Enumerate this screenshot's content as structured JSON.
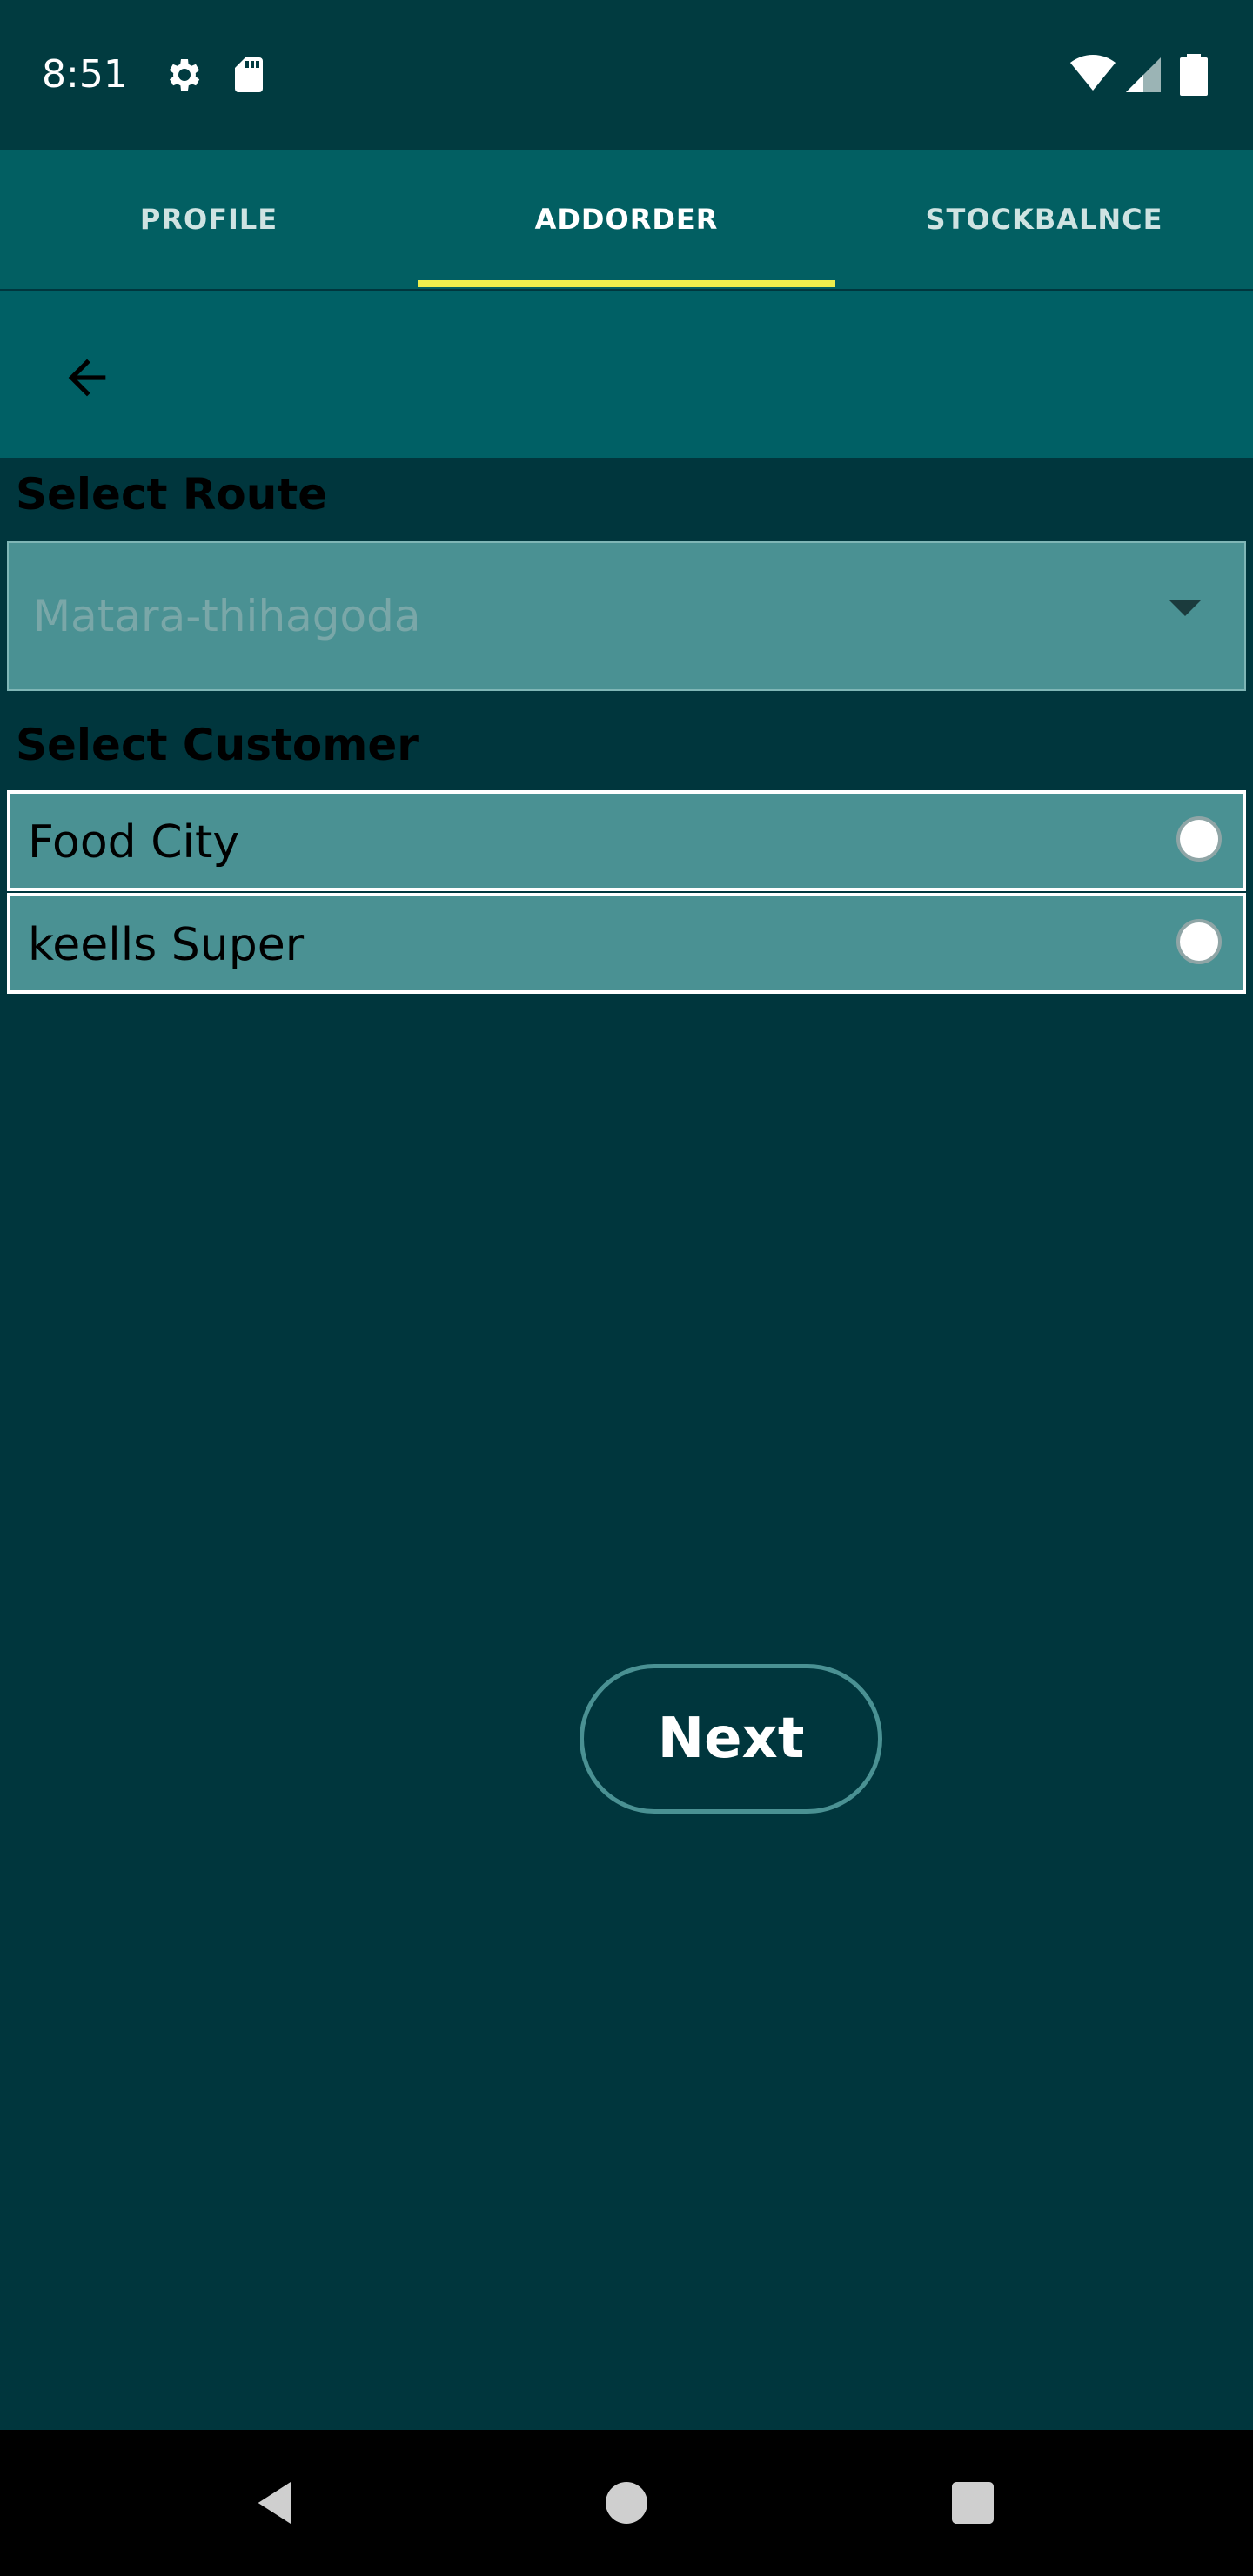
{
  "status_bar": {
    "time": "8:51",
    "icons": [
      "gear-icon",
      "sd-card-icon",
      "wifi-icon",
      "signal-icon",
      "battery-icon"
    ]
  },
  "tabs": [
    {
      "label": "PROFILE",
      "active": false
    },
    {
      "label": "ADDORDER",
      "active": true
    },
    {
      "label": "STOCKBALNCE",
      "active": false
    }
  ],
  "toolbar": {
    "back_icon": "arrow-left-icon"
  },
  "route": {
    "label": "Select Route",
    "selected": "Matara-thihagoda"
  },
  "customer": {
    "label": "Select Customer",
    "items": [
      {
        "name": "Food City",
        "selected": false
      },
      {
        "name": "keells Super",
        "selected": false
      }
    ]
  },
  "next_button": {
    "label": "Next"
  },
  "nav_bar": {
    "icons": [
      "back-triangle-icon",
      "home-circle-icon",
      "recents-square-icon"
    ]
  },
  "colors": {
    "background": "#00363d",
    "tab_bar": "#025f62",
    "toolbar": "#006065",
    "list_item": "#4a9193",
    "indicator": "#eded4d"
  }
}
